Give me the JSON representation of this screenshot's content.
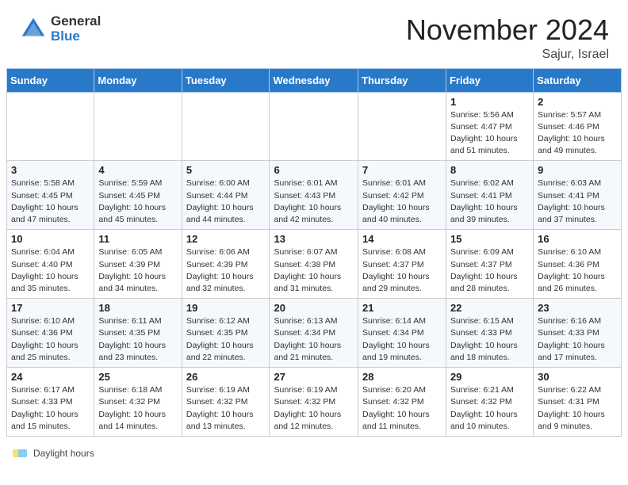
{
  "header": {
    "logo_general": "General",
    "logo_blue": "Blue",
    "month_title": "November 2024",
    "location": "Sajur, Israel"
  },
  "days_of_week": [
    "Sunday",
    "Monday",
    "Tuesday",
    "Wednesday",
    "Thursday",
    "Friday",
    "Saturday"
  ],
  "weeks": [
    [
      {
        "day": "",
        "info": ""
      },
      {
        "day": "",
        "info": ""
      },
      {
        "day": "",
        "info": ""
      },
      {
        "day": "",
        "info": ""
      },
      {
        "day": "",
        "info": ""
      },
      {
        "day": "1",
        "info": "Sunrise: 5:56 AM\nSunset: 4:47 PM\nDaylight: 10 hours and 51 minutes."
      },
      {
        "day": "2",
        "info": "Sunrise: 5:57 AM\nSunset: 4:46 PM\nDaylight: 10 hours and 49 minutes."
      }
    ],
    [
      {
        "day": "3",
        "info": "Sunrise: 5:58 AM\nSunset: 4:45 PM\nDaylight: 10 hours and 47 minutes."
      },
      {
        "day": "4",
        "info": "Sunrise: 5:59 AM\nSunset: 4:45 PM\nDaylight: 10 hours and 45 minutes."
      },
      {
        "day": "5",
        "info": "Sunrise: 6:00 AM\nSunset: 4:44 PM\nDaylight: 10 hours and 44 minutes."
      },
      {
        "day": "6",
        "info": "Sunrise: 6:01 AM\nSunset: 4:43 PM\nDaylight: 10 hours and 42 minutes."
      },
      {
        "day": "7",
        "info": "Sunrise: 6:01 AM\nSunset: 4:42 PM\nDaylight: 10 hours and 40 minutes."
      },
      {
        "day": "8",
        "info": "Sunrise: 6:02 AM\nSunset: 4:41 PM\nDaylight: 10 hours and 39 minutes."
      },
      {
        "day": "9",
        "info": "Sunrise: 6:03 AM\nSunset: 4:41 PM\nDaylight: 10 hours and 37 minutes."
      }
    ],
    [
      {
        "day": "10",
        "info": "Sunrise: 6:04 AM\nSunset: 4:40 PM\nDaylight: 10 hours and 35 minutes."
      },
      {
        "day": "11",
        "info": "Sunrise: 6:05 AM\nSunset: 4:39 PM\nDaylight: 10 hours and 34 minutes."
      },
      {
        "day": "12",
        "info": "Sunrise: 6:06 AM\nSunset: 4:39 PM\nDaylight: 10 hours and 32 minutes."
      },
      {
        "day": "13",
        "info": "Sunrise: 6:07 AM\nSunset: 4:38 PM\nDaylight: 10 hours and 31 minutes."
      },
      {
        "day": "14",
        "info": "Sunrise: 6:08 AM\nSunset: 4:37 PM\nDaylight: 10 hours and 29 minutes."
      },
      {
        "day": "15",
        "info": "Sunrise: 6:09 AM\nSunset: 4:37 PM\nDaylight: 10 hours and 28 minutes."
      },
      {
        "day": "16",
        "info": "Sunrise: 6:10 AM\nSunset: 4:36 PM\nDaylight: 10 hours and 26 minutes."
      }
    ],
    [
      {
        "day": "17",
        "info": "Sunrise: 6:10 AM\nSunset: 4:36 PM\nDaylight: 10 hours and 25 minutes."
      },
      {
        "day": "18",
        "info": "Sunrise: 6:11 AM\nSunset: 4:35 PM\nDaylight: 10 hours and 23 minutes."
      },
      {
        "day": "19",
        "info": "Sunrise: 6:12 AM\nSunset: 4:35 PM\nDaylight: 10 hours and 22 minutes."
      },
      {
        "day": "20",
        "info": "Sunrise: 6:13 AM\nSunset: 4:34 PM\nDaylight: 10 hours and 21 minutes."
      },
      {
        "day": "21",
        "info": "Sunrise: 6:14 AM\nSunset: 4:34 PM\nDaylight: 10 hours and 19 minutes."
      },
      {
        "day": "22",
        "info": "Sunrise: 6:15 AM\nSunset: 4:33 PM\nDaylight: 10 hours and 18 minutes."
      },
      {
        "day": "23",
        "info": "Sunrise: 6:16 AM\nSunset: 4:33 PM\nDaylight: 10 hours and 17 minutes."
      }
    ],
    [
      {
        "day": "24",
        "info": "Sunrise: 6:17 AM\nSunset: 4:33 PM\nDaylight: 10 hours and 15 minutes."
      },
      {
        "day": "25",
        "info": "Sunrise: 6:18 AM\nSunset: 4:32 PM\nDaylight: 10 hours and 14 minutes."
      },
      {
        "day": "26",
        "info": "Sunrise: 6:19 AM\nSunset: 4:32 PM\nDaylight: 10 hours and 13 minutes."
      },
      {
        "day": "27",
        "info": "Sunrise: 6:19 AM\nSunset: 4:32 PM\nDaylight: 10 hours and 12 minutes."
      },
      {
        "day": "28",
        "info": "Sunrise: 6:20 AM\nSunset: 4:32 PM\nDaylight: 10 hours and 11 minutes."
      },
      {
        "day": "29",
        "info": "Sunrise: 6:21 AM\nSunset: 4:32 PM\nDaylight: 10 hours and 10 minutes."
      },
      {
        "day": "30",
        "info": "Sunrise: 6:22 AM\nSunset: 4:31 PM\nDaylight: 10 hours and 9 minutes."
      }
    ]
  ],
  "footer": {
    "daylight_label": "Daylight hours"
  }
}
